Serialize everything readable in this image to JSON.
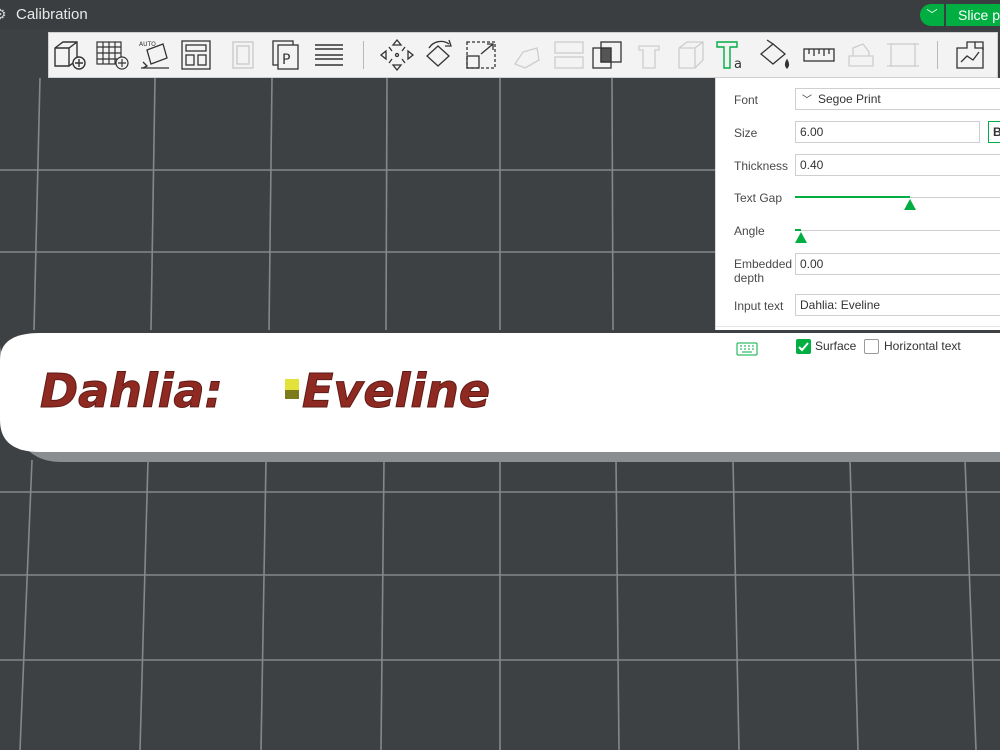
{
  "window": {
    "title": "Calibration",
    "slice_label": "Slice p",
    "accent": "#00ae42"
  },
  "toolbar": {
    "items": [
      {
        "name": "add-object-icon",
        "enabled": true
      },
      {
        "name": "add-plate-icon",
        "enabled": true
      },
      {
        "name": "auto-orient-icon",
        "enabled": true
      },
      {
        "name": "arrange-icon",
        "enabled": true
      },
      {
        "name": "split-objects-icon",
        "enabled": false
      },
      {
        "name": "split-parts-icon",
        "enabled": true
      },
      {
        "name": "layers-icon",
        "enabled": true
      },
      {
        "name": "move-icon",
        "enabled": true
      },
      {
        "name": "rotate-icon",
        "enabled": true
      },
      {
        "name": "scale-icon",
        "enabled": true
      },
      {
        "name": "lay-on-face-icon",
        "enabled": false
      },
      {
        "name": "cut-icon",
        "enabled": false
      },
      {
        "name": "boolean-icon",
        "enabled": true
      },
      {
        "name": "support-paint-icon",
        "enabled": false
      },
      {
        "name": "seam-paint-icon",
        "enabled": false
      },
      {
        "name": "text-tool-icon",
        "enabled": true
      },
      {
        "name": "color-paint-icon",
        "enabled": true
      },
      {
        "name": "measure-icon",
        "enabled": true
      },
      {
        "name": "assembly-icon",
        "enabled": false
      },
      {
        "name": "simplify-icon",
        "enabled": false
      },
      {
        "name": "assembly-view-icon",
        "enabled": true
      }
    ]
  },
  "text_panel": {
    "font_label": "Font",
    "font_value": "Segoe Print",
    "size_label": "Size",
    "size_value": "6.00",
    "bold_label": "B",
    "thickness_label": "Thickness",
    "thickness_value": "0.40",
    "gap_label": "Text Gap",
    "gap_level": 0.56,
    "angle_label": "Angle",
    "angle_level": 0.03,
    "depth_label": "Embedded\ndepth",
    "depth_value": "0.00",
    "input_label": "Input text",
    "input_value": "Dahlia: Eveline",
    "surface_label": "Surface",
    "surface_checked": true,
    "horizontal_label": "Horizontal text",
    "horizontal_checked": false
  },
  "model": {
    "text_left": "Dahlia:",
    "text_right": "Eveline",
    "text_color": "#8f2a22",
    "plate_color": "#ffffff"
  }
}
